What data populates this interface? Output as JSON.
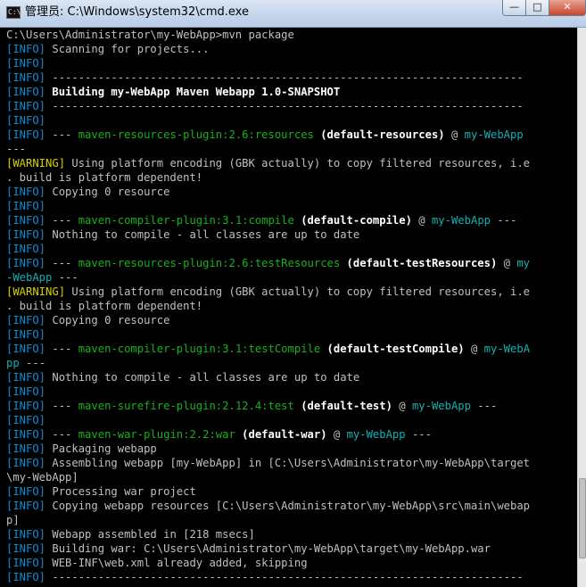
{
  "window": {
    "title": "管理员: C:\\Windows\\system32\\cmd.exe",
    "icon": "C:\\",
    "controls": {
      "minimize": "—",
      "maximize": "□",
      "close": "✕"
    }
  },
  "colors": {
    "background": "#000000",
    "text": "#c0c0c0",
    "info": "#0f8fd2",
    "plugin": "#1ab01a",
    "warning": "#d4d400",
    "project": "#16b0b0"
  },
  "console": {
    "lines": [
      [
        {
          "t": "C:\\Users\\Administrator\\my-WebApp>mvn package"
        }
      ],
      [
        {
          "c": "c-cyan",
          "t": "[INFO]"
        },
        {
          "t": " Scanning for projects..."
        }
      ],
      [
        {
          "c": "c-cyan",
          "t": "[INFO]"
        }
      ],
      [
        {
          "c": "c-cyan",
          "t": "[INFO]"
        },
        {
          "t": " ------------------------------------------------------------------------"
        }
      ],
      [
        {
          "c": "c-cyan",
          "t": "[INFO]"
        },
        {
          "c": "c-white",
          "t": " Building my-WebApp Maven Webapp 1.0-SNAPSHOT"
        }
      ],
      [
        {
          "c": "c-cyan",
          "t": "[INFO]"
        },
        {
          "t": " ------------------------------------------------------------------------"
        }
      ],
      [
        {
          "c": "c-cyan",
          "t": "[INFO]"
        }
      ],
      [
        {
          "c": "c-cyan",
          "t": "[INFO]"
        },
        {
          "t": " --- "
        },
        {
          "c": "c-green",
          "t": "maven-resources-plugin:2.6:resources"
        },
        {
          "c": "c-white",
          "t": " (default-resources)"
        },
        {
          "t": " @ "
        },
        {
          "c": "c-teal",
          "t": "my-WebApp"
        }
      ],
      [
        {
          "t": "---"
        }
      ],
      [
        {
          "c": "c-yellow",
          "t": "[WARNING]"
        },
        {
          "t": " Using platform encoding (GBK actually) to copy filtered resources, i.e"
        }
      ],
      [
        {
          "t": ". build is platform dependent!"
        }
      ],
      [
        {
          "c": "c-cyan",
          "t": "[INFO]"
        },
        {
          "t": " Copying 0 resource"
        }
      ],
      [
        {
          "c": "c-cyan",
          "t": "[INFO]"
        }
      ],
      [
        {
          "c": "c-cyan",
          "t": "[INFO]"
        },
        {
          "t": " --- "
        },
        {
          "c": "c-green",
          "t": "maven-compiler-plugin:3.1:compile"
        },
        {
          "c": "c-white",
          "t": " (default-compile)"
        },
        {
          "t": " @ "
        },
        {
          "c": "c-teal",
          "t": "my-WebApp"
        },
        {
          "t": " ---"
        }
      ],
      [
        {
          "c": "c-cyan",
          "t": "[INFO]"
        },
        {
          "t": " Nothing to compile - all classes are up to date"
        }
      ],
      [
        {
          "c": "c-cyan",
          "t": "[INFO]"
        }
      ],
      [
        {
          "c": "c-cyan",
          "t": "[INFO]"
        },
        {
          "t": " --- "
        },
        {
          "c": "c-green",
          "t": "maven-resources-plugin:2.6:testResources"
        },
        {
          "c": "c-white",
          "t": " (default-testResources)"
        },
        {
          "t": " @ "
        },
        {
          "c": "c-teal",
          "t": "my"
        }
      ],
      [
        {
          "c": "c-teal",
          "t": "-WebApp"
        },
        {
          "t": " ---"
        }
      ],
      [
        {
          "c": "c-yellow",
          "t": "[WARNING]"
        },
        {
          "t": " Using platform encoding (GBK actually) to copy filtered resources, i.e"
        }
      ],
      [
        {
          "t": ". build is platform dependent!"
        }
      ],
      [
        {
          "c": "c-cyan",
          "t": "[INFO]"
        },
        {
          "t": " Copying 0 resource"
        }
      ],
      [
        {
          "c": "c-cyan",
          "t": "[INFO]"
        }
      ],
      [
        {
          "c": "c-cyan",
          "t": "[INFO]"
        },
        {
          "t": " --- "
        },
        {
          "c": "c-green",
          "t": "maven-compiler-plugin:3.1:testCompile"
        },
        {
          "c": "c-white",
          "t": " (default-testCompile)"
        },
        {
          "t": " @ "
        },
        {
          "c": "c-teal",
          "t": "my-WebA"
        }
      ],
      [
        {
          "c": "c-teal",
          "t": "pp"
        },
        {
          "t": " ---"
        }
      ],
      [
        {
          "c": "c-cyan",
          "t": "[INFO]"
        },
        {
          "t": " Nothing to compile - all classes are up to date"
        }
      ],
      [
        {
          "c": "c-cyan",
          "t": "[INFO]"
        }
      ],
      [
        {
          "c": "c-cyan",
          "t": "[INFO]"
        },
        {
          "t": " --- "
        },
        {
          "c": "c-green",
          "t": "maven-surefire-plugin:2.12.4:test"
        },
        {
          "c": "c-white",
          "t": " (default-test)"
        },
        {
          "t": " @ "
        },
        {
          "c": "c-teal",
          "t": "my-WebApp"
        },
        {
          "t": " ---"
        }
      ],
      [
        {
          "c": "c-cyan",
          "t": "[INFO]"
        }
      ],
      [
        {
          "c": "c-cyan",
          "t": "[INFO]"
        },
        {
          "t": " --- "
        },
        {
          "c": "c-green",
          "t": "maven-war-plugin:2.2:war"
        },
        {
          "c": "c-white",
          "t": " (default-war)"
        },
        {
          "t": " @ "
        },
        {
          "c": "c-teal",
          "t": "my-WebApp"
        },
        {
          "t": " ---"
        }
      ],
      [
        {
          "c": "c-cyan",
          "t": "[INFO]"
        },
        {
          "t": " Packaging webapp"
        }
      ],
      [
        {
          "c": "c-cyan",
          "t": "[INFO]"
        },
        {
          "t": " Assembling webapp [my-WebApp] in [C:\\Users\\Administrator\\my-WebApp\\target"
        }
      ],
      [
        {
          "t": "\\my-WebApp]"
        }
      ],
      [
        {
          "c": "c-cyan",
          "t": "[INFO]"
        },
        {
          "t": " Processing war project"
        }
      ],
      [
        {
          "c": "c-cyan",
          "t": "[INFO]"
        },
        {
          "t": " Copying webapp resources [C:\\Users\\Administrator\\my-WebApp\\src\\main\\webap"
        }
      ],
      [
        {
          "t": "p]"
        }
      ],
      [
        {
          "c": "c-cyan",
          "t": "[INFO]"
        },
        {
          "t": " Webapp assembled in [218 msecs]"
        }
      ],
      [
        {
          "c": "c-cyan",
          "t": "[INFO]"
        },
        {
          "t": " Building war: C:\\Users\\Administrator\\my-WebApp\\target\\my-WebApp.war"
        }
      ],
      [
        {
          "c": "c-cyan",
          "t": "[INFO]"
        },
        {
          "t": " WEB-INF\\web.xml already added, skipping"
        }
      ],
      [
        {
          "c": "c-cyan",
          "t": "[INFO]"
        },
        {
          "t": " ------------------------------------------------------------------------"
        }
      ]
    ]
  }
}
